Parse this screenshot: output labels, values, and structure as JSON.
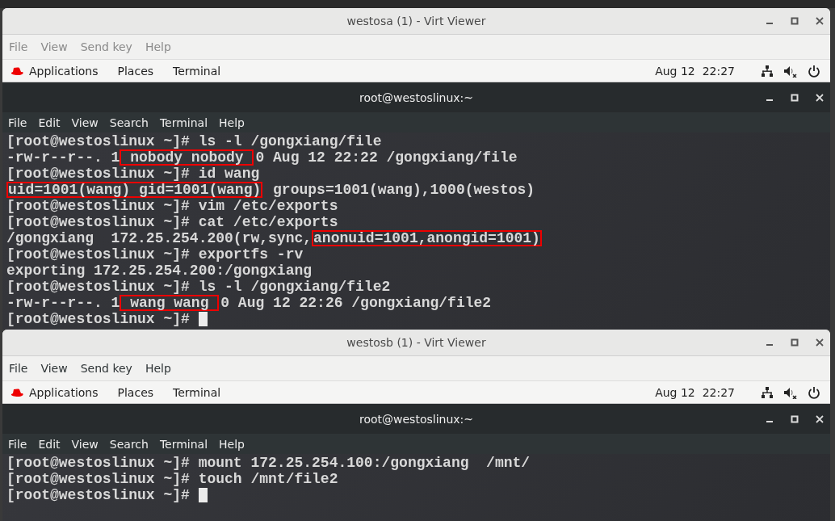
{
  "windows": [
    {
      "title": "westosa (1) - Virt Viewer",
      "active": false,
      "menu": [
        "File",
        "View",
        "Send key",
        "Help"
      ],
      "topbar": {
        "items": [
          "Applications",
          "Places",
          "Terminal"
        ],
        "clock": "Aug 12  22:27"
      },
      "terminal": {
        "title": "root@westoslinux:~",
        "menu": [
          "File",
          "Edit",
          "View",
          "Search",
          "Terminal",
          "Help"
        ],
        "lines": [
          [
            {
              "text": "[root@westoslinux ~]# ls -l /gongxiang/file",
              "boxed": false
            }
          ],
          [
            {
              "text": "-rw-r--r--. 1",
              "boxed": false
            },
            {
              "text": " nobody nobody ",
              "boxed": true
            },
            {
              "text": "0 Aug 12 22:22 /gongxiang/file",
              "boxed": false
            }
          ],
          [
            {
              "text": "[root@westoslinux ~]# id wang",
              "boxed": false
            }
          ],
          [
            {
              "text": "uid=1001(wang) gid=1001(wang)",
              "boxed": true
            },
            {
              "text": " groups=1001(wang),1000(westos)",
              "boxed": false
            }
          ],
          [
            {
              "text": "[root@westoslinux ~]# vim /etc/exports",
              "boxed": false
            }
          ],
          [
            {
              "text": "[root@westoslinux ~]# cat /etc/exports",
              "boxed": false
            }
          ],
          [
            {
              "text": "/gongxiang  172.25.254.200(rw,sync,",
              "boxed": false
            },
            {
              "text": "anonuid=1001,anongid=1001)",
              "boxed": true
            }
          ],
          [
            {
              "text": "[root@westoslinux ~]# exportfs -rv",
              "boxed": false
            }
          ],
          [
            {
              "text": "exporting 172.25.254.200:/gongxiang",
              "boxed": false
            }
          ],
          [
            {
              "text": "[root@westoslinux ~]# ls -l /gongxiang/file2",
              "boxed": false
            }
          ],
          [
            {
              "text": "-rw-r--r--. 1",
              "boxed": false
            },
            {
              "text": " wang wang ",
              "boxed": true
            },
            {
              "text": "0 Aug 12 22:26 /gongxiang/file2",
              "boxed": false
            }
          ],
          [
            {
              "text": "[root@westoslinux ~]# ",
              "boxed": false,
              "cursor": true
            }
          ]
        ]
      }
    },
    {
      "title": "westosb (1) - Virt Viewer",
      "active": true,
      "menu": [
        "File",
        "View",
        "Send key",
        "Help"
      ],
      "topbar": {
        "items": [
          "Applications",
          "Places",
          "Terminal"
        ],
        "clock": "Aug 12  22:27"
      },
      "terminal": {
        "title": "root@westoslinux:~",
        "menu": [
          "File",
          "Edit",
          "View",
          "Search",
          "Terminal",
          "Help"
        ],
        "lines": [
          [
            {
              "text": "[root@westoslinux ~]# mount 172.25.254.100:/gongxiang  /mnt/",
              "boxed": false
            }
          ],
          [
            {
              "text": "[root@westoslinux ~]# touch /mnt/file2",
              "boxed": false
            }
          ],
          [
            {
              "text": "[root@westoslinux ~]# ",
              "boxed": false,
              "cursor": true
            }
          ]
        ]
      }
    }
  ]
}
